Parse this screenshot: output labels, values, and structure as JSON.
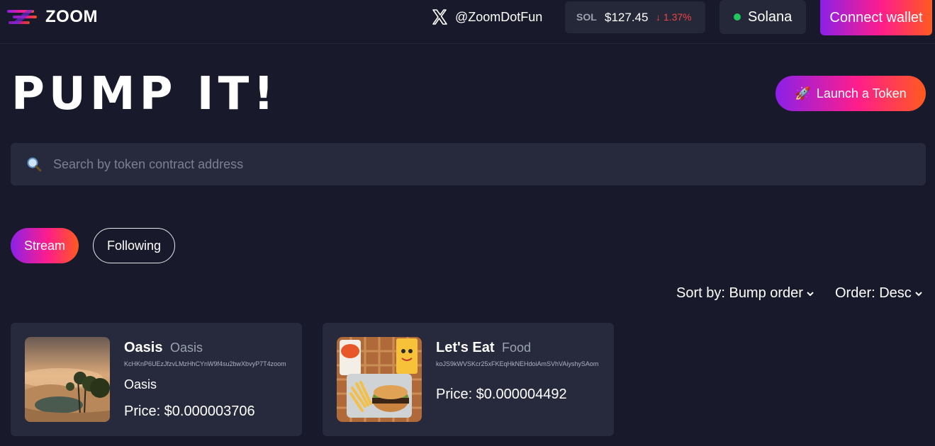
{
  "header": {
    "brand": "ZOOM",
    "twitter_handle": "@ZoomDotFun",
    "sol_ticker": "SOL",
    "sol_price": "$127.45",
    "sol_change": "↓ 1.37%",
    "network": "Solana",
    "connect_label": "Connect wallet"
  },
  "hero": {
    "title": "PUMP IT!",
    "launch_label": "Launch a Token"
  },
  "search": {
    "placeholder": "Search by token contract address",
    "value": ""
  },
  "tabs": [
    {
      "label": "Stream",
      "active": true
    },
    {
      "label": "Following",
      "active": false
    }
  ],
  "sort": {
    "sort_label": "Sort by: Bump order",
    "order_label": "Order: Desc"
  },
  "tokens": [
    {
      "name": "Oasis",
      "ticker": "Oasis",
      "address": "KcHKnP6UEzJfzvLMzHhCYnW9f4su2bwXbvyP7T4zoom",
      "description": "Oasis",
      "price": "Price: $0.000003706"
    },
    {
      "name": "Let's Eat",
      "ticker": "Food",
      "address": "koJS9kWVSKcr25xFKEqHkNEHdoiAmSVhVAiyshySAom",
      "description": "",
      "price": "Price: $0.000004492"
    }
  ],
  "colors": {
    "background": "#181a2b",
    "panel": "#272a3d",
    "gradient_start": "#8b20e8",
    "gradient_mid": "#ff1e8a",
    "gradient_end": "#ff5a1f",
    "negative": "#ef4444",
    "online": "#22c55e"
  }
}
